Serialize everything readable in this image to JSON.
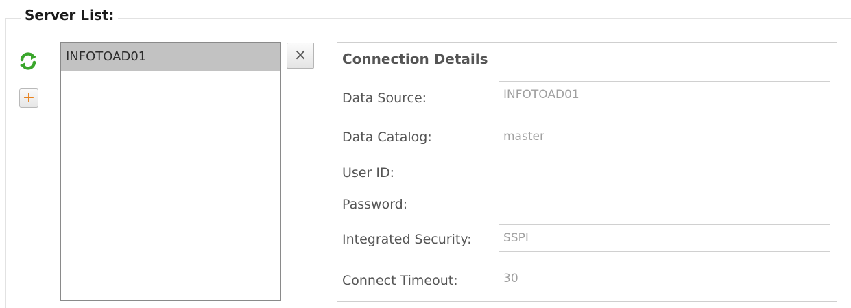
{
  "group": {
    "title": "Server List:"
  },
  "toolbar": {
    "refresh_icon": "refresh-arrows-icon",
    "add_icon": "plus-icon",
    "add_glyph": "+",
    "delete_glyph": "×",
    "accent_green": "#3aa62c",
    "accent_orange": "#e8821e"
  },
  "servers": {
    "items": [
      {
        "label": "INFOTOAD01",
        "selected": true
      }
    ]
  },
  "details": {
    "title": "Connection Details",
    "fields": [
      {
        "label": "Data Source:",
        "value": "INFOTOAD01",
        "has_input": true
      },
      {
        "label": "Data Catalog:",
        "value": "master",
        "has_input": true
      },
      {
        "label": "User ID:",
        "value": "",
        "has_input": false
      },
      {
        "label": "Password:",
        "value": "",
        "has_input": false
      },
      {
        "label": "Integrated Security:",
        "value": "SSPI",
        "has_input": true
      },
      {
        "label": "Connect Timeout:",
        "value": "30",
        "has_input": true
      }
    ]
  }
}
